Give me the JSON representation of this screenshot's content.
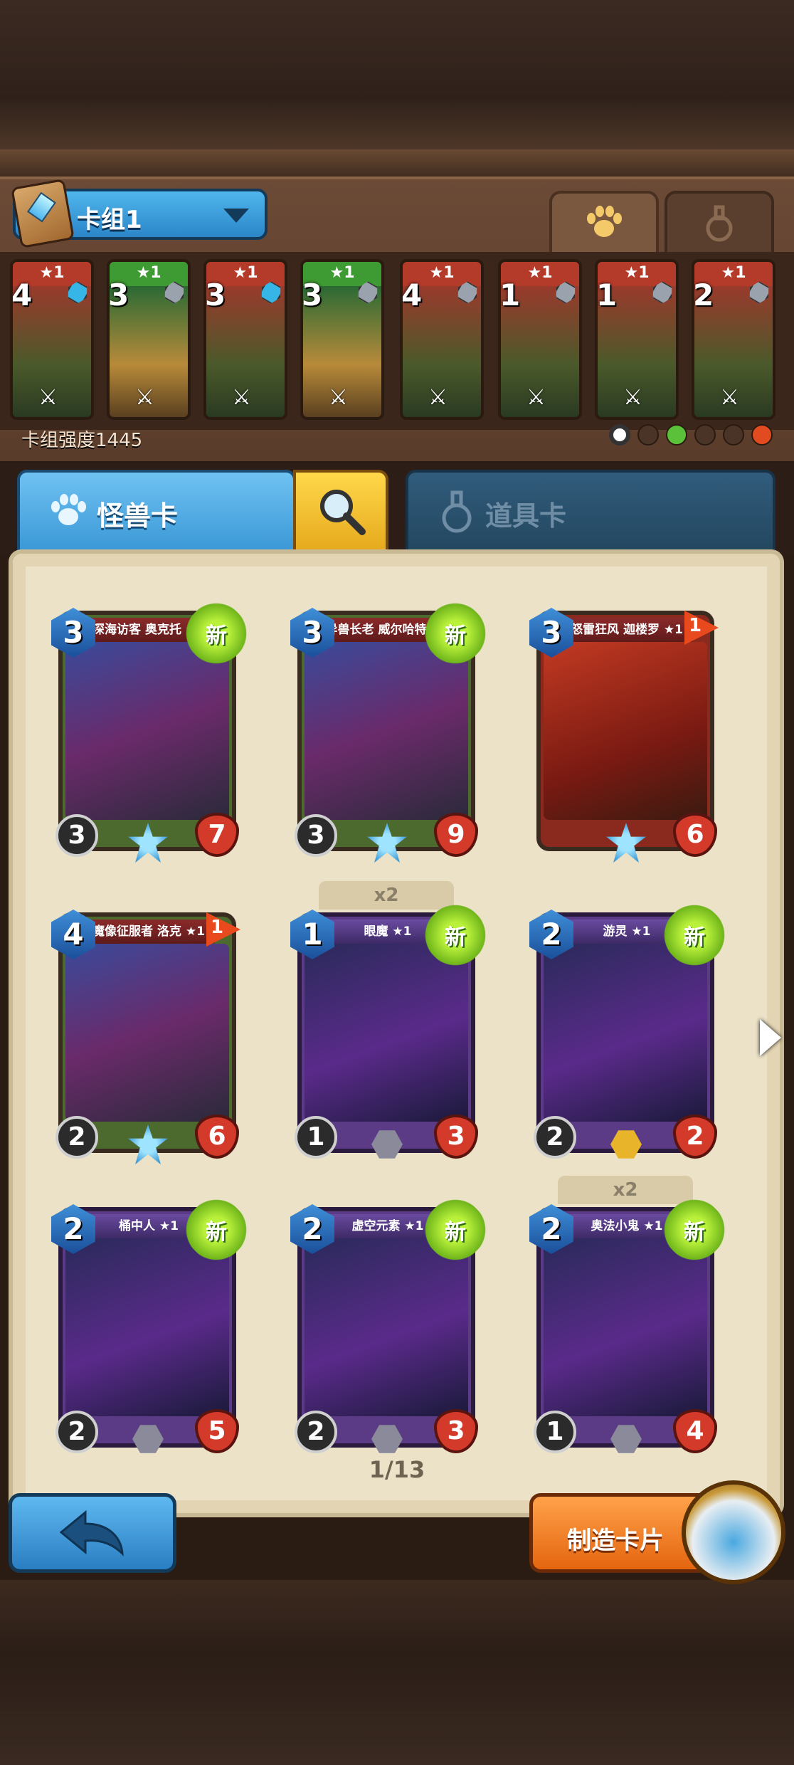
{
  "deck": {
    "name": "卡组1",
    "power_label": "卡组强度1445"
  },
  "deck_cards": [
    {
      "stars": "★1",
      "cost": "4",
      "color": "red",
      "gem": "blue"
    },
    {
      "stars": "★1",
      "cost": "3",
      "color": "green",
      "gem": "gray"
    },
    {
      "stars": "★1",
      "cost": "3",
      "color": "red",
      "gem": "blue"
    },
    {
      "stars": "★1",
      "cost": "3",
      "color": "green",
      "gem": "gray"
    },
    {
      "stars": "★1",
      "cost": "4",
      "color": "red",
      "gem": "gray"
    },
    {
      "stars": "★1",
      "cost": "1",
      "color": "red",
      "gem": "gray"
    },
    {
      "stars": "★1",
      "cost": "1",
      "color": "red",
      "gem": "gray"
    },
    {
      "stars": "★1",
      "cost": "2",
      "color": "red",
      "gem": "gray"
    }
  ],
  "tabs": {
    "monster": "怪兽卡",
    "items": "道具卡"
  },
  "cards": [
    {
      "name": "深海访客 奥克托 ★1",
      "cost": "3",
      "atk": "3",
      "hp": "7",
      "new": "新",
      "theme": "green",
      "rarity": "star"
    },
    {
      "name": "异兽长老 威尔哈特 ★1",
      "cost": "3",
      "atk": "3",
      "hp": "9",
      "new": "新",
      "theme": "green",
      "rarity": "star"
    },
    {
      "name": "怒雷狂风 迦楼罗 ★1",
      "cost": "3",
      "atk": "",
      "hp": "6",
      "flag": "1",
      "theme": "red",
      "rarity": "star"
    },
    {
      "name": "魔像征服者 洛克 ★1",
      "cost": "4",
      "atk": "2",
      "hp": "6",
      "flag": "1",
      "theme": "green",
      "rarity": "star"
    },
    {
      "name": "眼魔 ★1",
      "cost": "1",
      "atk": "1",
      "hp": "3",
      "new": "新",
      "count": "x2",
      "theme": "purple",
      "rarity": "gray"
    },
    {
      "name": "游灵 ★1",
      "cost": "2",
      "atk": "2",
      "hp": "2",
      "new": "新",
      "theme": "purple",
      "rarity": "gold"
    },
    {
      "name": "桶中人 ★1",
      "cost": "2",
      "atk": "2",
      "hp": "5",
      "new": "新",
      "theme": "purple",
      "rarity": "gray"
    },
    {
      "name": "虚空元素 ★1",
      "cost": "2",
      "atk": "2",
      "hp": "3",
      "new": "新",
      "theme": "purple",
      "rarity": "gray"
    },
    {
      "name": "奥法小鬼 ★1",
      "cost": "2",
      "atk": "1",
      "hp": "4",
      "new": "新",
      "count": "x2",
      "theme": "purple",
      "rarity": "gray"
    }
  ],
  "pagination": "1/13",
  "buttons": {
    "craft": "制造卡片"
  },
  "icons": [
    "paw-icon",
    "flask-icon",
    "search-icon",
    "back-arrow-icon",
    "next-page-icon",
    "deck-book-icon",
    "sword-icon",
    "potion-jar-icon"
  ]
}
